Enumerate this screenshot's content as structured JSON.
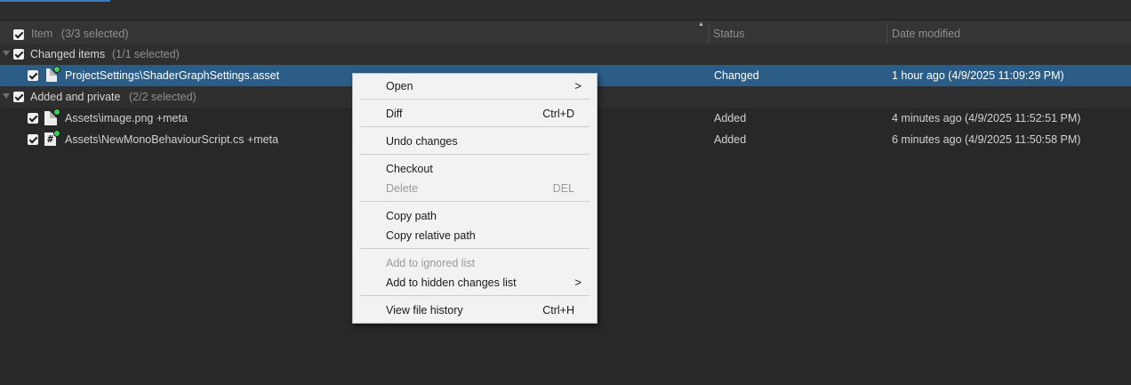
{
  "header": {
    "item_label": "Item",
    "item_count": "(3/3 selected)",
    "status_label": "Status",
    "date_label": "Date modified"
  },
  "groups": [
    {
      "label": "Changed items",
      "count": "(1/1 selected)",
      "rows": [
        {
          "name": "ProjectSettings\\ShaderGraphSettings.asset",
          "status": "Changed",
          "date": "1 hour ago (4/9/2025 11:09:29 PM)",
          "icon": "file-icon"
        }
      ]
    },
    {
      "label": "Added and private",
      "count": "(2/2 selected)",
      "rows": [
        {
          "name": "Assets\\image.png +meta",
          "status": "Added",
          "date": "4 minutes ago (4/9/2025 11:52:51 PM)",
          "icon": "file-icon"
        },
        {
          "name": "Assets\\NewMonoBehaviourScript.cs +meta",
          "status": "Added",
          "date": "6 minutes ago (4/9/2025 11:50:58 PM)",
          "icon": "csharp-script-icon",
          "icon_glyph": "#"
        }
      ]
    }
  ],
  "context_menu": {
    "open": "Open",
    "diff": "Diff",
    "diff_shortcut": "Ctrl+D",
    "undo_changes": "Undo changes",
    "checkout": "Checkout",
    "delete": "Delete",
    "delete_shortcut": "DEL",
    "copy_path": "Copy path",
    "copy_relative_path": "Copy relative path",
    "add_to_ignored_list": "Add to ignored list",
    "add_to_hidden_changes_list": "Add to hidden changes list",
    "view_file_history": "View file history",
    "view_file_history_shortcut": "Ctrl+H",
    "submenu_arrow": ">"
  },
  "colors": {
    "background": "#282828",
    "selected_row": "#2c5d87",
    "added_badge": "#3fcf55",
    "menu_background": "#f2f2f2"
  }
}
